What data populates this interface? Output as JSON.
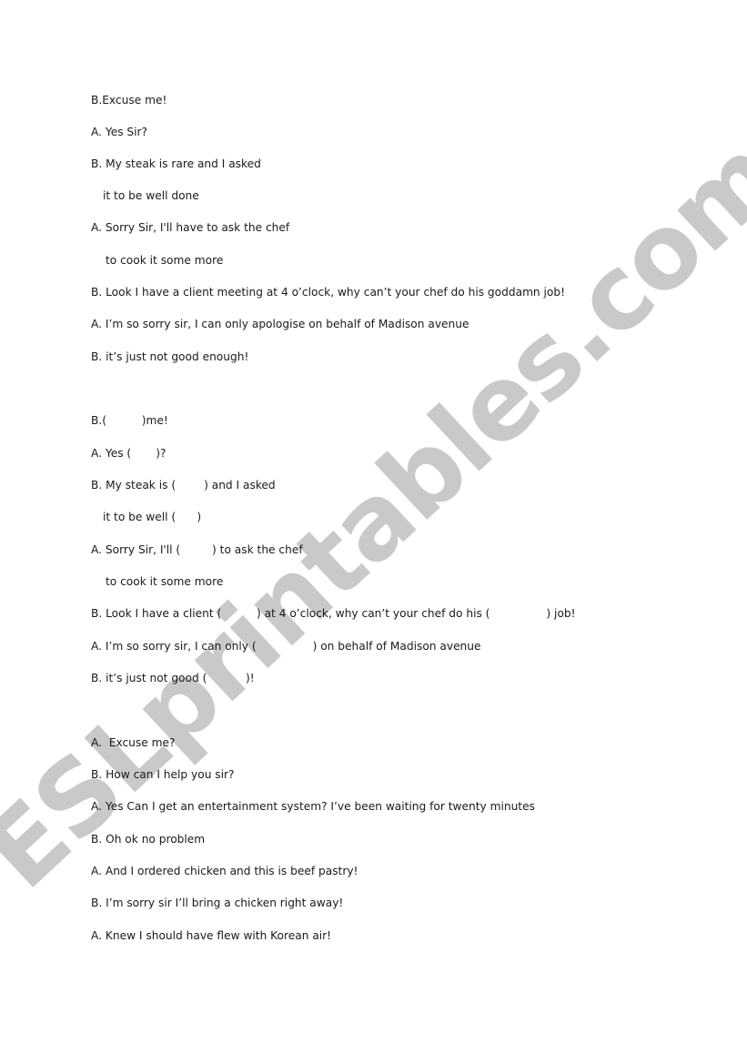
{
  "watermark": {
    "text": "ESLprintables.com",
    "color": "#c9c9c9"
  },
  "sections": [
    {
      "name": "original-dialogue-1",
      "lines": [
        "B.Excuse me!",
        "A. Yes Sir?",
        "B. My steak is rare and I asked",
        "it to be well done",
        "A. Sorry Sir, I'll have to ask the chef",
        "to cook it some more",
        "B. Look I have a client meeting at 4 o’clock, why can’t your chef do his goddamn job!",
        "A. I’m so sorry sir, I can only apologise on behalf of Madison avenue",
        "B. it’s just not good enough!"
      ]
    },
    {
      "name": "gap-fill-dialogue",
      "lines": [
        "B.(          )me!",
        "A. Yes (       )?",
        "B. My steak is (        ) and I asked",
        "it to be well (      )",
        "A. Sorry Sir, I'll (         ) to ask the chef",
        "to cook it some more",
        "B. Look I have a client (          ) at 4 o’clock, why can’t your chef do his (                ) job!",
        "A. I’m so sorry sir, I can only (                ) on behalf of Madison avenue",
        "B. it’s just not good (           )!"
      ]
    },
    {
      "name": "original-dialogue-2",
      "lines": [
        "A.  Excuse me?",
        "B. How can I help you sir?",
        "A. Yes Can I get an entertainment system? I’ve been waiting for twenty minutes",
        "B. Oh ok no problem",
        "A. And I ordered chicken and this is beef pastry!",
        "B. I’m sorry sir I’ll bring a chicken right away!",
        "A. Knew I should have flew with Korean air!"
      ]
    }
  ]
}
